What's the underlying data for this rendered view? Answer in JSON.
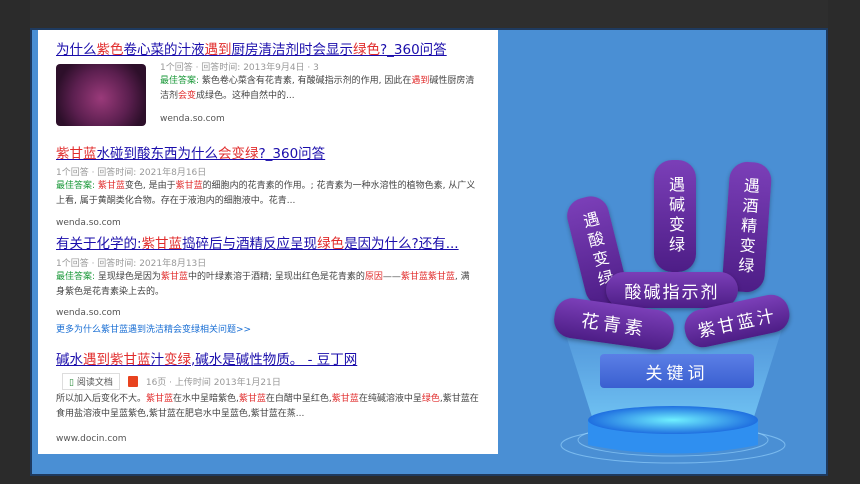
{
  "results": [
    {
      "title_parts": [
        {
          "t": "为什么",
          "h": false
        },
        {
          "t": "紫色",
          "h": true
        },
        {
          "t": "卷心菜的汁液",
          "h": false
        },
        {
          "t": "遇到",
          "h": true
        },
        {
          "t": "厨房清洁剂时会显示",
          "h": false
        },
        {
          "t": "绿色",
          "h": true
        },
        {
          "t": "?_360问答",
          "h": false
        }
      ],
      "meta": "1个回答 · 回答时间: 2013年9月4日 · 3",
      "snippet": [
        {
          "t": "最佳答案: ",
          "c": "g"
        },
        {
          "t": "紫色卷心菜含有花青素, 有酸碱指示剂的作用, 因此在",
          "c": ""
        },
        {
          "t": "遇到",
          "c": "hl"
        },
        {
          "t": "碱性厨房清洁剂",
          "c": ""
        },
        {
          "t": "会变",
          "c": "hl"
        },
        {
          "t": "成绿色。这种自然中的...",
          "c": ""
        }
      ],
      "url": "wenda.so.com"
    },
    {
      "title_parts": [
        {
          "t": "紫甘蓝",
          "h": true
        },
        {
          "t": "水碰到酸东西为什么",
          "h": false
        },
        {
          "t": "会变绿",
          "h": true
        },
        {
          "t": "?_360问答",
          "h": false
        }
      ],
      "meta": "1个回答 · 回答时间: 2021年8月16日",
      "snippet": [
        {
          "t": "最佳答案: ",
          "c": "g"
        },
        {
          "t": "紫甘蓝",
          "c": "hl"
        },
        {
          "t": "变色, 是由于",
          "c": ""
        },
        {
          "t": "紫甘蓝",
          "c": "hl"
        },
        {
          "t": "的细胞内的花青素的作用。; 花青素为一种水溶性的植物色素, 从广义上看, 属于黄酮类化合物。存在于液泡内的细胞液中。花青...",
          "c": ""
        }
      ],
      "url": "wenda.so.com"
    },
    {
      "title_parts": [
        {
          "t": "有关于化学的:",
          "h": false
        },
        {
          "t": "紫甘蓝",
          "h": true
        },
        {
          "t": "捣碎后与酒精反应呈现",
          "h": false
        },
        {
          "t": "绿色",
          "h": true
        },
        {
          "t": "是因为什么?还有...",
          "h": false
        }
      ],
      "meta": "1个回答 · 回答时间: 2021年8月13日",
      "snippet": [
        {
          "t": "最佳答案: ",
          "c": "g"
        },
        {
          "t": "呈现绿色是因为",
          "c": ""
        },
        {
          "t": "紫甘蓝",
          "c": "hl"
        },
        {
          "t": "中的叶绿素溶于酒精; 呈现出红色是花青素的",
          "c": ""
        },
        {
          "t": "原因",
          "c": "hl"
        },
        {
          "t": "——",
          "c": ""
        },
        {
          "t": "紫甘蓝紫甘蓝",
          "c": "hl"
        },
        {
          "t": ", 满身紫色是花青素染上去的。",
          "c": ""
        }
      ],
      "url": "wenda.so.com",
      "more": "更多为什么紫甘蓝遇到洗洁精会变绿相关问题>>"
    },
    {
      "title_parts": [
        {
          "t": "碱水",
          "h": false
        },
        {
          "t": "遇到",
          "h": true
        },
        {
          "t": "紫甘蓝",
          "h": true
        },
        {
          "t": "汁",
          "h": false
        },
        {
          "t": "变绿",
          "h": true
        },
        {
          "t": ",碱水是碱性物质。 - 豆丁网",
          "h": false
        }
      ],
      "doc_label": "阅读文档",
      "meta": "16页 · 上传时间 2013年1月21日",
      "snippet": [
        {
          "t": "所以加入后变化不大。",
          "c": ""
        },
        {
          "t": "紫甘蓝",
          "c": "hl"
        },
        {
          "t": "在水中呈暗紫色,",
          "c": ""
        },
        {
          "t": "紫甘蓝",
          "c": "hl"
        },
        {
          "t": "在白醋中呈红色,",
          "c": ""
        },
        {
          "t": "紫甘蓝",
          "c": "hl"
        },
        {
          "t": "在纯碱溶液中呈",
          "c": ""
        },
        {
          "t": "绿色",
          "c": "hl"
        },
        {
          "t": ",紫甘蓝在食用盐溶液中呈蓝紫色,紫甘蓝在肥皂水中呈蓝色,紫甘蓝在蒸...",
          "c": ""
        }
      ],
      "url": "www.docin.com"
    }
  ],
  "keywords": {
    "meet_acid_change_green": "遇酸变绿",
    "meet_base_change_green": "遇碱变绿",
    "meet_alcohol_change_green": "遇酒精变绿",
    "indicator": "酸碱指示剂",
    "anthocyanin": "花青素",
    "purple_cabbage_juice": "紫甘蓝汁",
    "keyword_label": "关键词"
  },
  "colors": {
    "frame_blue": "#4a8fd4",
    "pill_purple": "#5b2a99",
    "link_blue": "#1a0dab",
    "highlight_red": "#e12c2c"
  }
}
